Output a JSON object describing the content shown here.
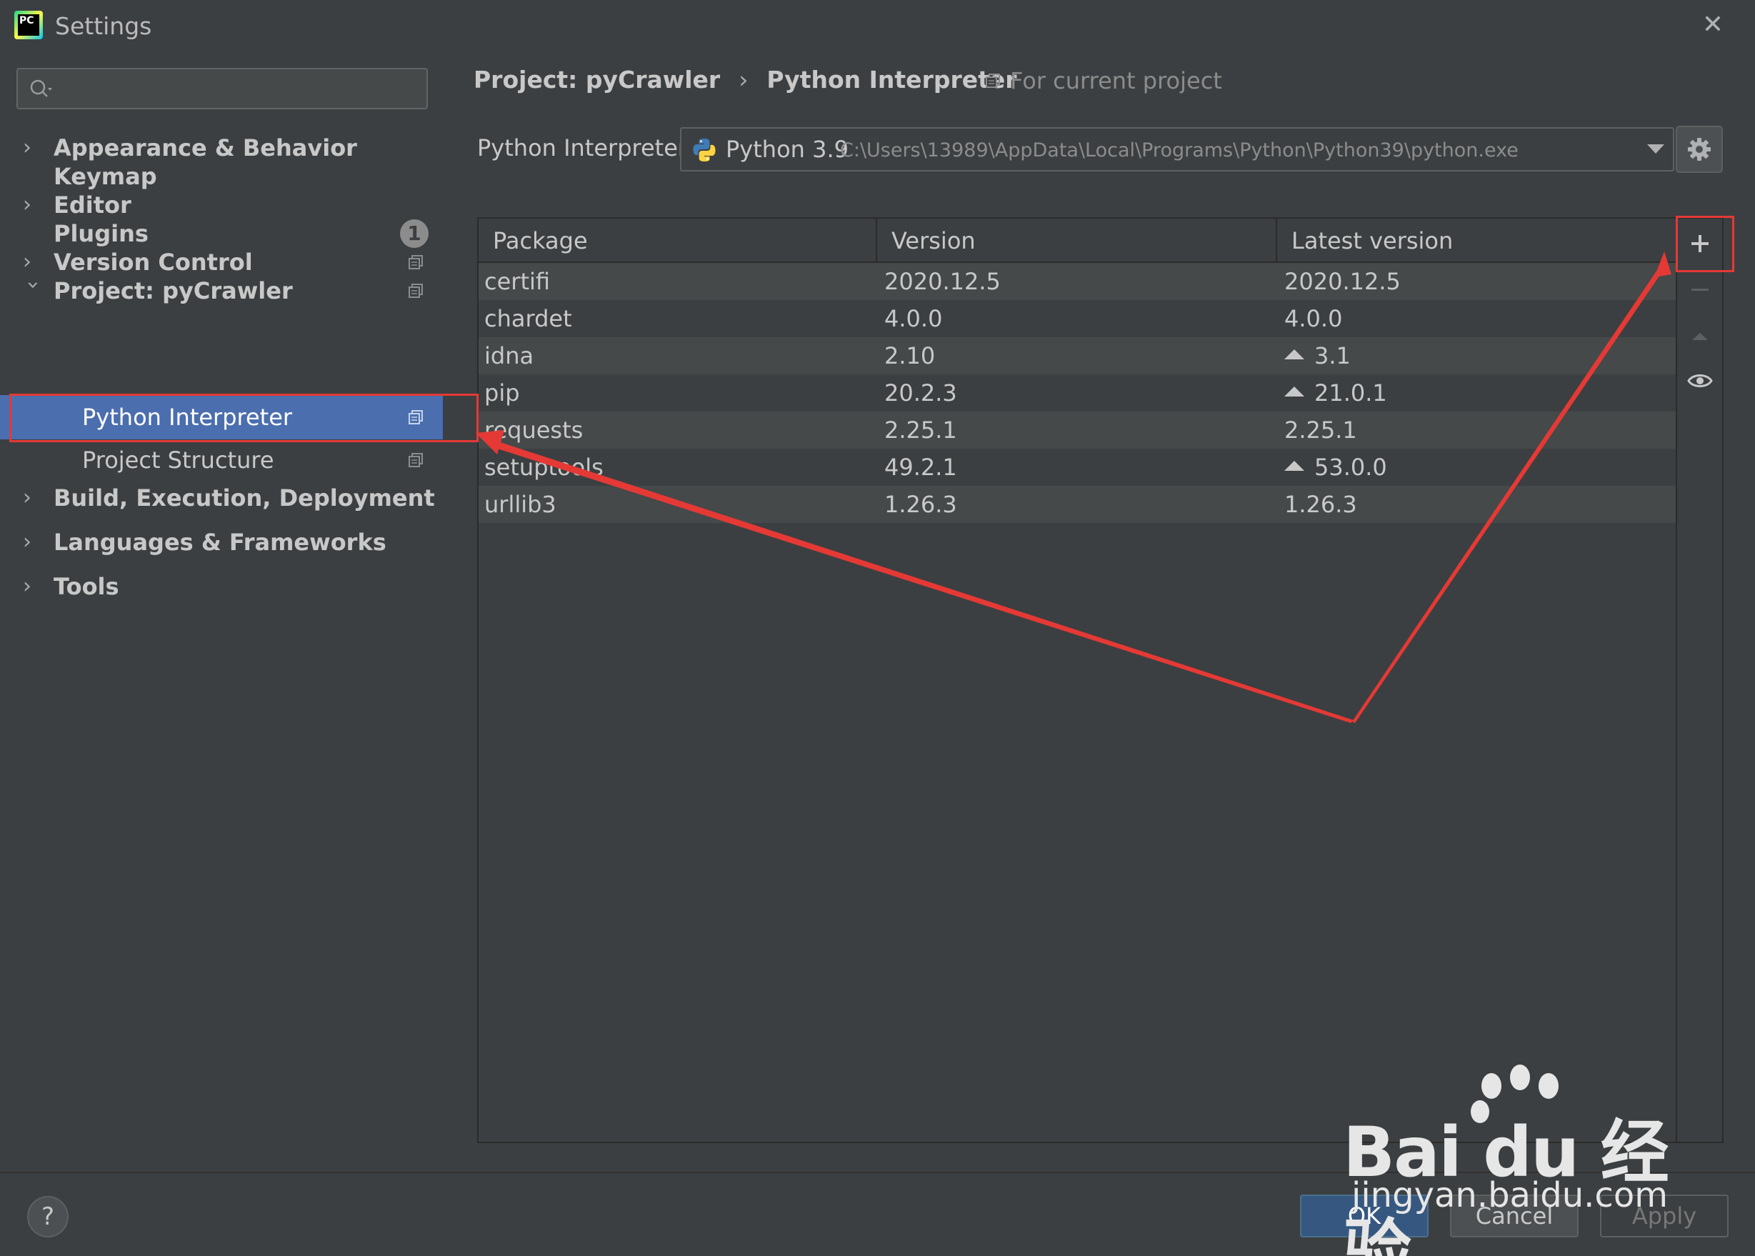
{
  "window": {
    "title": "Settings",
    "app_logo_text": "PC"
  },
  "sidebar": {
    "search_placeholder": "",
    "items": [
      {
        "label": "Appearance & Behavior",
        "expandable": true,
        "expanded": false,
        "level": 0
      },
      {
        "label": "Keymap",
        "expandable": false,
        "level": 0
      },
      {
        "label": "Editor",
        "expandable": true,
        "expanded": false,
        "level": 0
      },
      {
        "label": "Plugins",
        "expandable": false,
        "level": 0,
        "badge": "1"
      },
      {
        "label": "Version Control",
        "expandable": true,
        "expanded": false,
        "level": 0,
        "project_icon": true
      },
      {
        "label": "Project: pyCrawler",
        "expandable": true,
        "expanded": true,
        "level": 0,
        "project_icon": true
      },
      {
        "label": "Python Interpreter",
        "expandable": false,
        "level": 1,
        "selected": true,
        "project_icon": true
      },
      {
        "label": "Project Structure",
        "expandable": false,
        "level": 1,
        "project_icon": true
      },
      {
        "label": "Build, Execution, Deployment",
        "expandable": true,
        "expanded": false,
        "level": 0
      },
      {
        "label": "Languages & Frameworks",
        "expandable": true,
        "expanded": false,
        "level": 0
      },
      {
        "label": "Tools",
        "expandable": true,
        "expanded": false,
        "level": 0
      }
    ]
  },
  "main": {
    "breadcrumb": [
      "Project: pyCrawler",
      "Python Interpreter"
    ],
    "breadcrumb_sep": "›",
    "for_current_project": "For current project",
    "interpreter_label": "Python Interpreter:",
    "interpreter_name": "Python 3.9",
    "interpreter_path": "C:\\Users\\13989\\AppData\\Local\\Programs\\Python\\Python39\\python.exe",
    "table": {
      "headers": [
        "Package",
        "Version",
        "Latest version"
      ],
      "rows": [
        {
          "package": "certifi",
          "version": "2020.12.5",
          "latest": "2020.12.5",
          "upgrade": false
        },
        {
          "package": "chardet",
          "version": "4.0.0",
          "latest": "4.0.0",
          "upgrade": false
        },
        {
          "package": "idna",
          "version": "2.10",
          "latest": "3.1",
          "upgrade": true
        },
        {
          "package": "pip",
          "version": "20.2.3",
          "latest": "21.0.1",
          "upgrade": true
        },
        {
          "package": "requests",
          "version": "2.25.1",
          "latest": "2.25.1",
          "upgrade": false
        },
        {
          "package": "setuptools",
          "version": "49.2.1",
          "latest": "53.0.0",
          "upgrade": true
        },
        {
          "package": "urllib3",
          "version": "1.26.3",
          "latest": "1.26.3",
          "upgrade": false
        }
      ]
    },
    "toolbar": [
      "plus-icon",
      "minus-icon",
      "upgrade-icon",
      "eye-icon"
    ]
  },
  "footer": {
    "help": "?",
    "ok": "OK",
    "cancel": "Cancel",
    "apply": "Apply"
  },
  "watermark": {
    "brand": "Bai du 经验",
    "url": "jingyan.baidu.com"
  },
  "colors": {
    "background": "#3c3f41",
    "selection": "#4b6eaf",
    "annotation": "#e53935",
    "ok_button": "#365880"
  }
}
